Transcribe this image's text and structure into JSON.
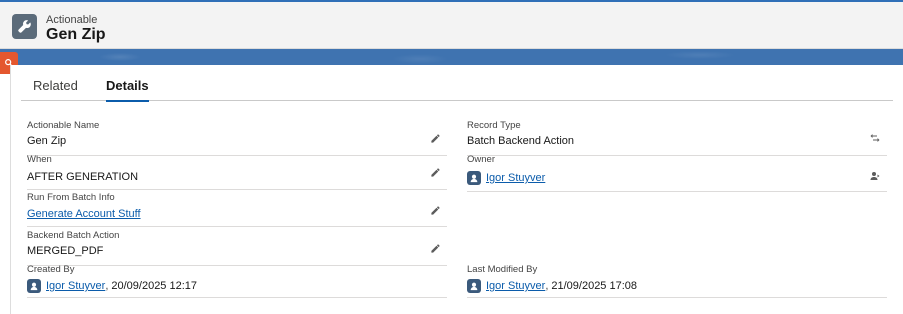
{
  "header": {
    "object_type": "Actionable",
    "record_title": "Gen Zip",
    "icon": "wrench-icon"
  },
  "tabs": [
    {
      "label": "Related",
      "active": false
    },
    {
      "label": "Details",
      "active": true
    }
  ],
  "left_fields": [
    {
      "label": "Actionable Name",
      "value": "Gen Zip"
    },
    {
      "label": "When",
      "value": "AFTER GENERATION"
    },
    {
      "label": "Run From Batch Info",
      "value": "Generate Account Stuff"
    },
    {
      "label": "Backend Batch Action",
      "value": "MERGED_PDF"
    }
  ],
  "right_fields": [
    {
      "label": "Record Type",
      "value": "Batch Backend Action"
    },
    {
      "label": "Owner",
      "value": "Igor Stuyver"
    }
  ],
  "system": {
    "created_by": {
      "label": "Created By",
      "user": "Igor Stuyver",
      "date": "20/09/2025 12:17"
    },
    "last_modified_by": {
      "label": "Last Modified By",
      "user": "Igor Stuyver",
      "date": "21/09/2025 17:08"
    }
  },
  "colors": {
    "brand_blue": "#3f73b0",
    "link": "#0b5cab",
    "side_tab": "#e4572e"
  }
}
